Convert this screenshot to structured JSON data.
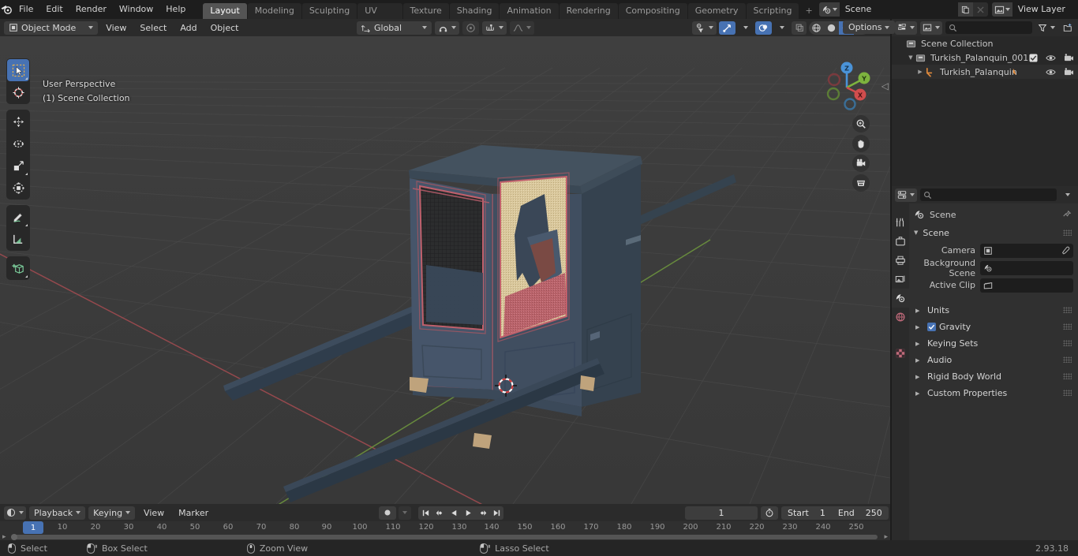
{
  "app": {
    "version": "2.93.18"
  },
  "topbar": {
    "menus": [
      "File",
      "Edit",
      "Render",
      "Window",
      "Help"
    ],
    "workspaces": [
      {
        "label": "Layout",
        "active": true
      },
      {
        "label": "Modeling",
        "active": false
      },
      {
        "label": "Sculpting",
        "active": false
      },
      {
        "label": "UV Editing",
        "active": false
      },
      {
        "label": "Texture Paint",
        "active": false
      },
      {
        "label": "Shading",
        "active": false
      },
      {
        "label": "Animation",
        "active": false
      },
      {
        "label": "Rendering",
        "active": false
      },
      {
        "label": "Compositing",
        "active": false
      },
      {
        "label": "Geometry Nodes",
        "active": false
      },
      {
        "label": "Scripting",
        "active": false
      }
    ],
    "add_workspace": "+",
    "scene_name": "Scene",
    "viewlayer_name": "View Layer"
  },
  "viewport": {
    "mode": "Object Mode",
    "menus": [
      "View",
      "Select",
      "Add",
      "Object"
    ],
    "transform_orientation": "Global",
    "overlay_line1": "User Perspective",
    "overlay_line2": "(1) Scene Collection",
    "gizmo_axes": {
      "z": "Z",
      "y": "Y",
      "x": "X"
    },
    "tools": [
      {
        "name": "tweak-tool",
        "selected": true
      },
      {
        "name": "cursor-tool",
        "selected": false
      },
      {
        "name": "move-tool",
        "selected": false
      },
      {
        "name": "rotate-tool",
        "selected": false
      },
      {
        "name": "scale-tool",
        "selected": false
      },
      {
        "name": "transform-tool",
        "selected": false
      },
      {
        "name": "annotate-tool",
        "selected": false
      },
      {
        "name": "measure-tool",
        "selected": false
      },
      {
        "name": "add-cube-tool",
        "selected": false
      }
    ]
  },
  "outliner": {
    "options_label": "Options",
    "rows": [
      {
        "label": "Scene Collection",
        "depth": 0,
        "icon": "collection-icon",
        "expandable": false,
        "has_checkbox": false,
        "has_eye": false,
        "has_camera": false
      },
      {
        "label": "Turkish_Palanquin_001",
        "depth": 1,
        "icon": "collection-icon",
        "expandable": true,
        "has_checkbox": true,
        "has_eye": true,
        "has_camera": true
      },
      {
        "label": "Turkish_Palanquin",
        "depth": 2,
        "icon": "mesh-data-icon",
        "expandable": true,
        "has_checkbox": false,
        "has_eye": true,
        "has_camera": true
      }
    ]
  },
  "properties": {
    "breadcrumb": "Scene",
    "panel_title": "Scene",
    "fields": [
      {
        "label": "Camera",
        "value": "",
        "icon": "camera-object-icon",
        "eyedropper": true
      },
      {
        "label": "Background Scene",
        "value": "",
        "icon": "scene-icon",
        "eyedropper": false
      },
      {
        "label": "Active Clip",
        "value": "",
        "icon": "clip-icon",
        "eyedropper": false
      }
    ],
    "subpanels": [
      {
        "label": "Units",
        "checkbox": false
      },
      {
        "label": "Gravity",
        "checkbox": true,
        "checked": true
      },
      {
        "label": "Keying Sets",
        "checkbox": false
      },
      {
        "label": "Audio",
        "checkbox": false
      },
      {
        "label": "Rigid Body World",
        "checkbox": false
      },
      {
        "label": "Custom Properties",
        "checkbox": false
      }
    ],
    "tabs": [
      {
        "name": "tool-tab",
        "active": false
      },
      {
        "name": "render-tab",
        "active": false
      },
      {
        "name": "output-tab",
        "active": false
      },
      {
        "name": "view-layer-tab",
        "active": false
      },
      {
        "name": "scene-tab",
        "active": true
      },
      {
        "name": "world-tab",
        "active": false
      },
      {
        "name": "texture-tab",
        "active": false
      }
    ]
  },
  "timeline": {
    "playback_label": "Playback",
    "keying_label": "Keying",
    "menus": [
      "View",
      "Marker"
    ],
    "current_frame": "1",
    "start_label": "Start",
    "start_value": "1",
    "end_label": "End",
    "end_value": "250",
    "ticks": [
      10,
      20,
      30,
      40,
      50,
      60,
      70,
      80,
      90,
      100,
      110,
      120,
      130,
      140,
      150,
      160,
      170,
      180,
      190,
      200,
      210,
      220,
      230,
      240,
      250
    ],
    "playhead_frame": "1"
  },
  "status": {
    "items": [
      {
        "label": "Select",
        "mouse": "left"
      },
      {
        "label": "Box Select",
        "mouse": "left-drag"
      },
      {
        "label": "Zoom View",
        "mouse": "middle"
      },
      {
        "label": "Lasso Select",
        "mouse": "left-drag"
      }
    ]
  },
  "colors": {
    "accent": "#4772b3",
    "viewport_bg": "#3b3b3b",
    "panel_bg": "#303030",
    "header_bg": "#2b2b2b",
    "axis_x": "#9b4a4f",
    "axis_y": "#6a8f3e"
  }
}
